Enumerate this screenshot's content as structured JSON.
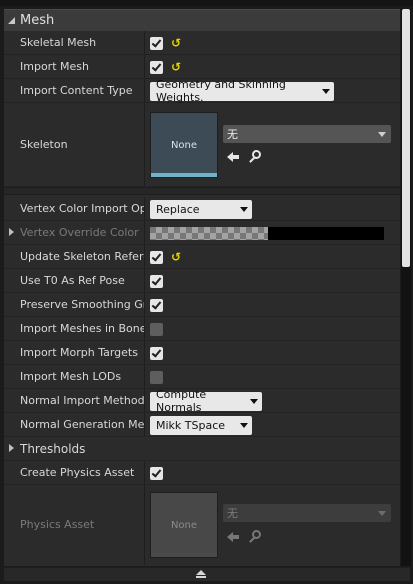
{
  "section": {
    "title": "Mesh"
  },
  "rows": {
    "skeletal_mesh": {
      "label": "Skeletal Mesh",
      "checked": true,
      "reset": true
    },
    "import_mesh": {
      "label": "Import Mesh",
      "checked": true,
      "reset": true
    },
    "import_content_type": {
      "label": "Import Content Type",
      "value": "Geometry and Skinning Weights."
    },
    "skeleton": {
      "label": "Skeleton",
      "thumb_label": "None",
      "asset_value": "无"
    },
    "vertex_color_import": {
      "label": "Vertex Color Import Opti",
      "value": "Replace"
    },
    "vertex_override_color": {
      "label": "Vertex Override Color"
    },
    "update_skeleton_ref": {
      "label": "Update Skeleton Referer",
      "checked": true,
      "reset": true
    },
    "use_t0": {
      "label": "Use T0 As Ref Pose",
      "checked": true
    },
    "preserve_smoothing": {
      "label": "Preserve Smoothing Gro",
      "checked": true
    },
    "import_meshes_bone": {
      "label": "Import Meshes in Bone H",
      "checked": false
    },
    "import_morph": {
      "label": "Import Morph Targets",
      "checked": true
    },
    "import_mesh_lods": {
      "label": "Import Mesh LODs",
      "checked": false
    },
    "normal_import": {
      "label": "Normal Import Method",
      "value": "Compute Normals"
    },
    "normal_generation": {
      "label": "Normal Generation Meth",
      "value": "Mikk TSpace"
    },
    "thresholds": {
      "label": "Thresholds"
    },
    "create_physics": {
      "label": "Create Physics Asset",
      "checked": true
    },
    "physics_asset": {
      "label": "Physics Asset",
      "thumb_label": "None",
      "asset_value": "无"
    }
  },
  "icons": {
    "reset": "↺",
    "browse": "arrow-left-icon",
    "find": "search-icon"
  },
  "colors": {
    "accent": "#6fb2cc",
    "reset": "#e8d300"
  }
}
